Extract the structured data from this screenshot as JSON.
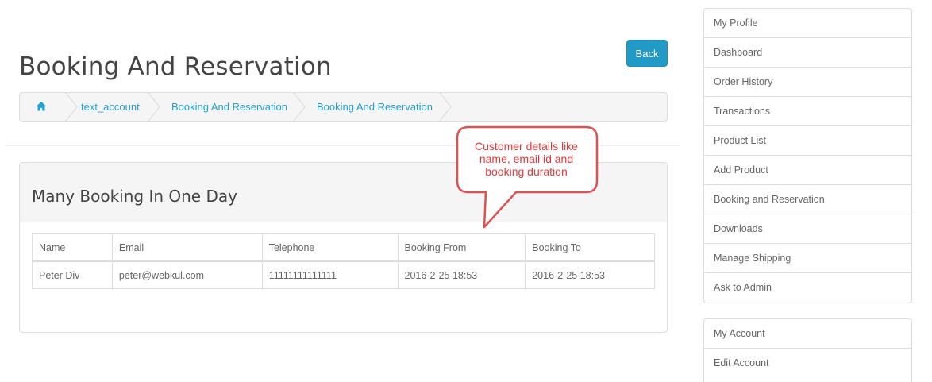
{
  "header": {
    "title": "Booking And Reservation",
    "back_label": "Back"
  },
  "breadcrumb": {
    "home_icon": "home-icon",
    "items": [
      "text_account",
      "Booking And Reservation",
      "Booking And Reservation"
    ]
  },
  "panel": {
    "title": "Many Booking In One Day",
    "table": {
      "columns": [
        "Name",
        "Email",
        "Telephone",
        "Booking From",
        "Booking To"
      ],
      "rows": [
        [
          "Peter Div",
          "peter@webkul.com",
          "11111111111111",
          "2016-2-25 18:53",
          "2016-2-25 18:53"
        ]
      ]
    }
  },
  "callout": {
    "lines": [
      "Customer details like",
      "name, email id and",
      "booking duration"
    ],
    "color": "#e23a3a"
  },
  "sidebar": {
    "items": [
      "My Profile",
      "Dashboard",
      "Order History",
      "Transactions",
      "Product List",
      "Add Product",
      "Booking and Reservation",
      "Downloads",
      "Manage Shipping",
      "Ask to Admin"
    ]
  },
  "sidebar2": {
    "items": [
      "My Account",
      "Edit Account"
    ]
  },
  "colors": {
    "accent": "#229ac8",
    "link": "#23a1d1"
  }
}
